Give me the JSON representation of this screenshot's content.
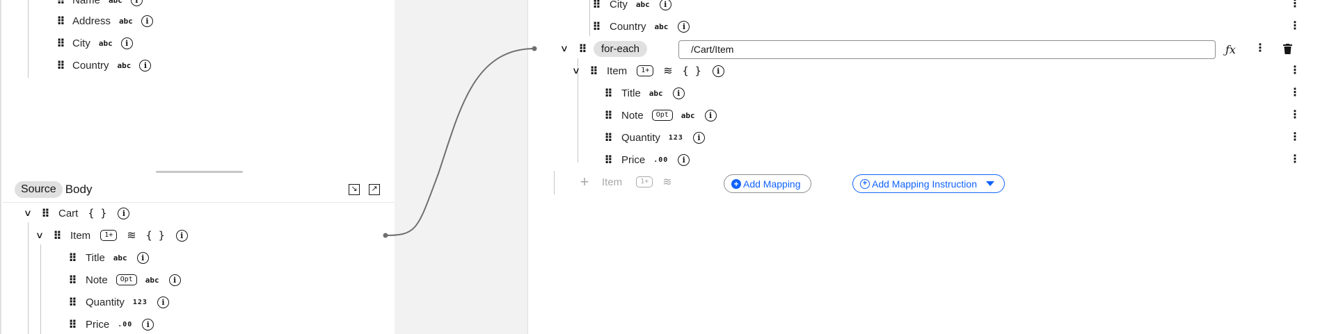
{
  "source_panel": {
    "target_schema_rows": [
      {
        "label": "Name",
        "type": "abc"
      },
      {
        "label": "Address",
        "type": "abc"
      },
      {
        "label": "City",
        "type": "abc"
      },
      {
        "label": "Country",
        "type": "abc"
      }
    ],
    "header": {
      "tag": "Source",
      "title": "Body"
    },
    "tree": {
      "root": {
        "label": "Cart",
        "type": "{ }"
      },
      "item": {
        "label": "Item",
        "cardinality": "1+",
        "type": "{ }"
      },
      "fields": [
        {
          "label": "Title",
          "badge": "",
          "type": "abc"
        },
        {
          "label": "Note",
          "badge": "Opt",
          "type": "abc"
        },
        {
          "label": "Quantity",
          "badge": "",
          "type": "123"
        },
        {
          "label": "Price",
          "badge": "",
          "type": ".00"
        }
      ]
    }
  },
  "mapping_panel": {
    "top_rows": [
      {
        "label": "City",
        "type": "abc"
      },
      {
        "label": "Country",
        "type": "abc"
      }
    ],
    "for_each": {
      "tag": "for-each",
      "expression": "/Cart/Item"
    },
    "item": {
      "label": "Item",
      "cardinality": "1+",
      "type": "{ }"
    },
    "fields": [
      {
        "label": "Title",
        "badge": "",
        "type": "abc"
      },
      {
        "label": "Note",
        "badge": "Opt",
        "type": "abc"
      },
      {
        "label": "Quantity",
        "badge": "",
        "type": "123"
      },
      {
        "label": "Price",
        "badge": "",
        "type": ".00"
      }
    ],
    "add_row": {
      "label": "Item",
      "cardinality": "1+"
    },
    "add_mapping_label": "Add Mapping",
    "add_instruction_label": "Add Mapping Instruction"
  },
  "icons": {
    "drag": "drag-handle-icon",
    "info": "information-icon",
    "stack": "layers-icon",
    "kebab": "overflow-menu-icon",
    "fx": "function-icon",
    "trash": "trash-icon"
  },
  "colors": {
    "accent": "#0f62fe",
    "muted": "#a8a8a8",
    "gap": "#f2f2f2"
  }
}
